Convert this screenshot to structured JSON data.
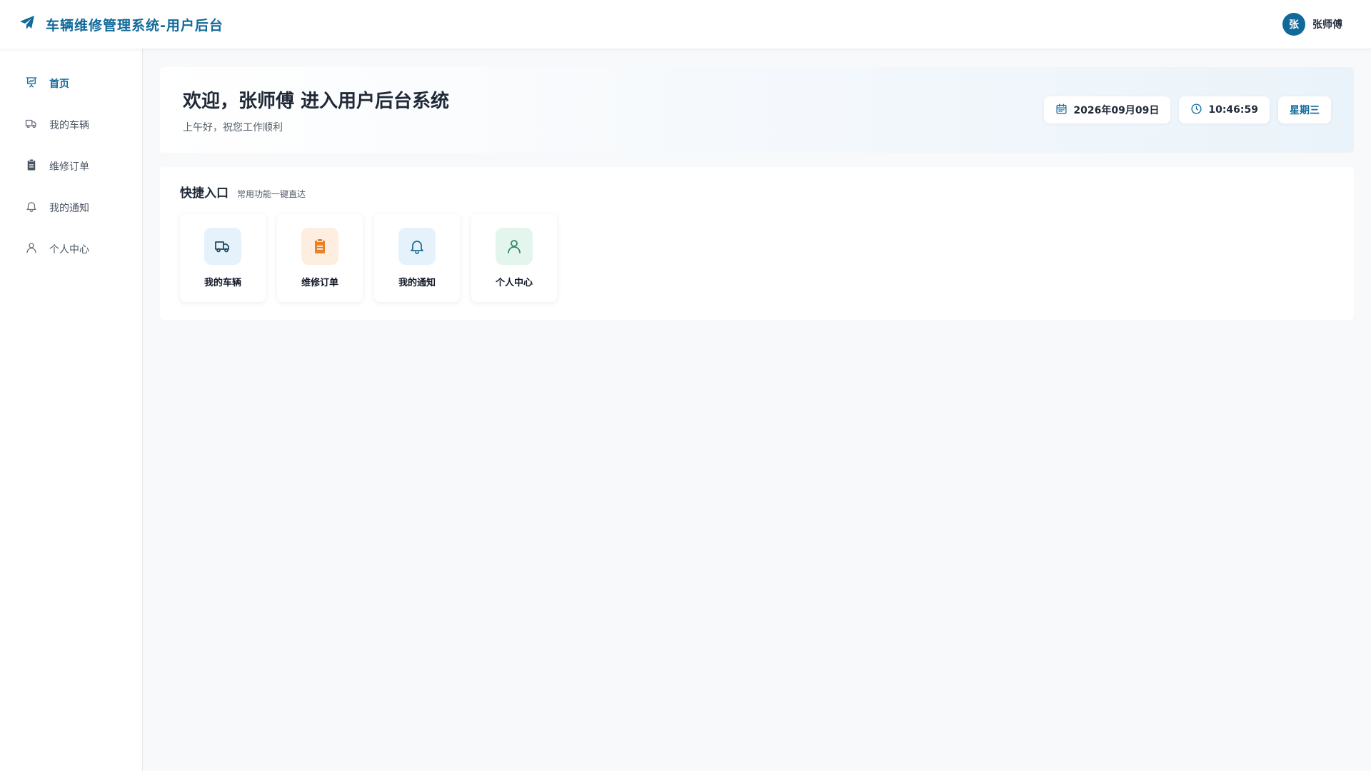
{
  "header": {
    "title": "车辆维修管理系统-用户后台",
    "logo_icon": "paper-plane-icon",
    "user": {
      "avatar_text": "张",
      "name": "张师傅"
    }
  },
  "sidebar": {
    "items": [
      {
        "label": "首页",
        "icon": "presentation-chart-icon",
        "active": true
      },
      {
        "label": "我的车辆",
        "icon": "truck-icon",
        "active": false
      },
      {
        "label": "维修订单",
        "icon": "clipboard-icon",
        "active": false
      },
      {
        "label": "我的通知",
        "icon": "bell-icon",
        "active": false
      },
      {
        "label": "个人中心",
        "icon": "user-icon",
        "active": false
      }
    ]
  },
  "welcome": {
    "title": "欢迎，张师傅 进入用户后台系统",
    "subtitle": "上午好，祝您工作顺利",
    "date": "2026年09月09日",
    "time": "10:46:59",
    "weekday": "星期三"
  },
  "quick": {
    "title": "快捷入口",
    "subtitle": "常用功能一键直达",
    "cards": [
      {
        "label": "我的车辆",
        "icon": "truck-icon",
        "bg": "#e6f2fb",
        "color": "#1f4b63"
      },
      {
        "label": "维修订单",
        "icon": "clipboard-icon",
        "bg": "#fdeee0",
        "color": "#e8822a"
      },
      {
        "label": "我的通知",
        "icon": "bell-icon",
        "bg": "#e6f2fb",
        "color": "#1f6e94"
      },
      {
        "label": "个人中心",
        "icon": "user-icon",
        "bg": "#e4f5ee",
        "color": "#2f8a62"
      }
    ]
  },
  "colors": {
    "brand": "#10699a",
    "background": "#f7f9fb"
  }
}
